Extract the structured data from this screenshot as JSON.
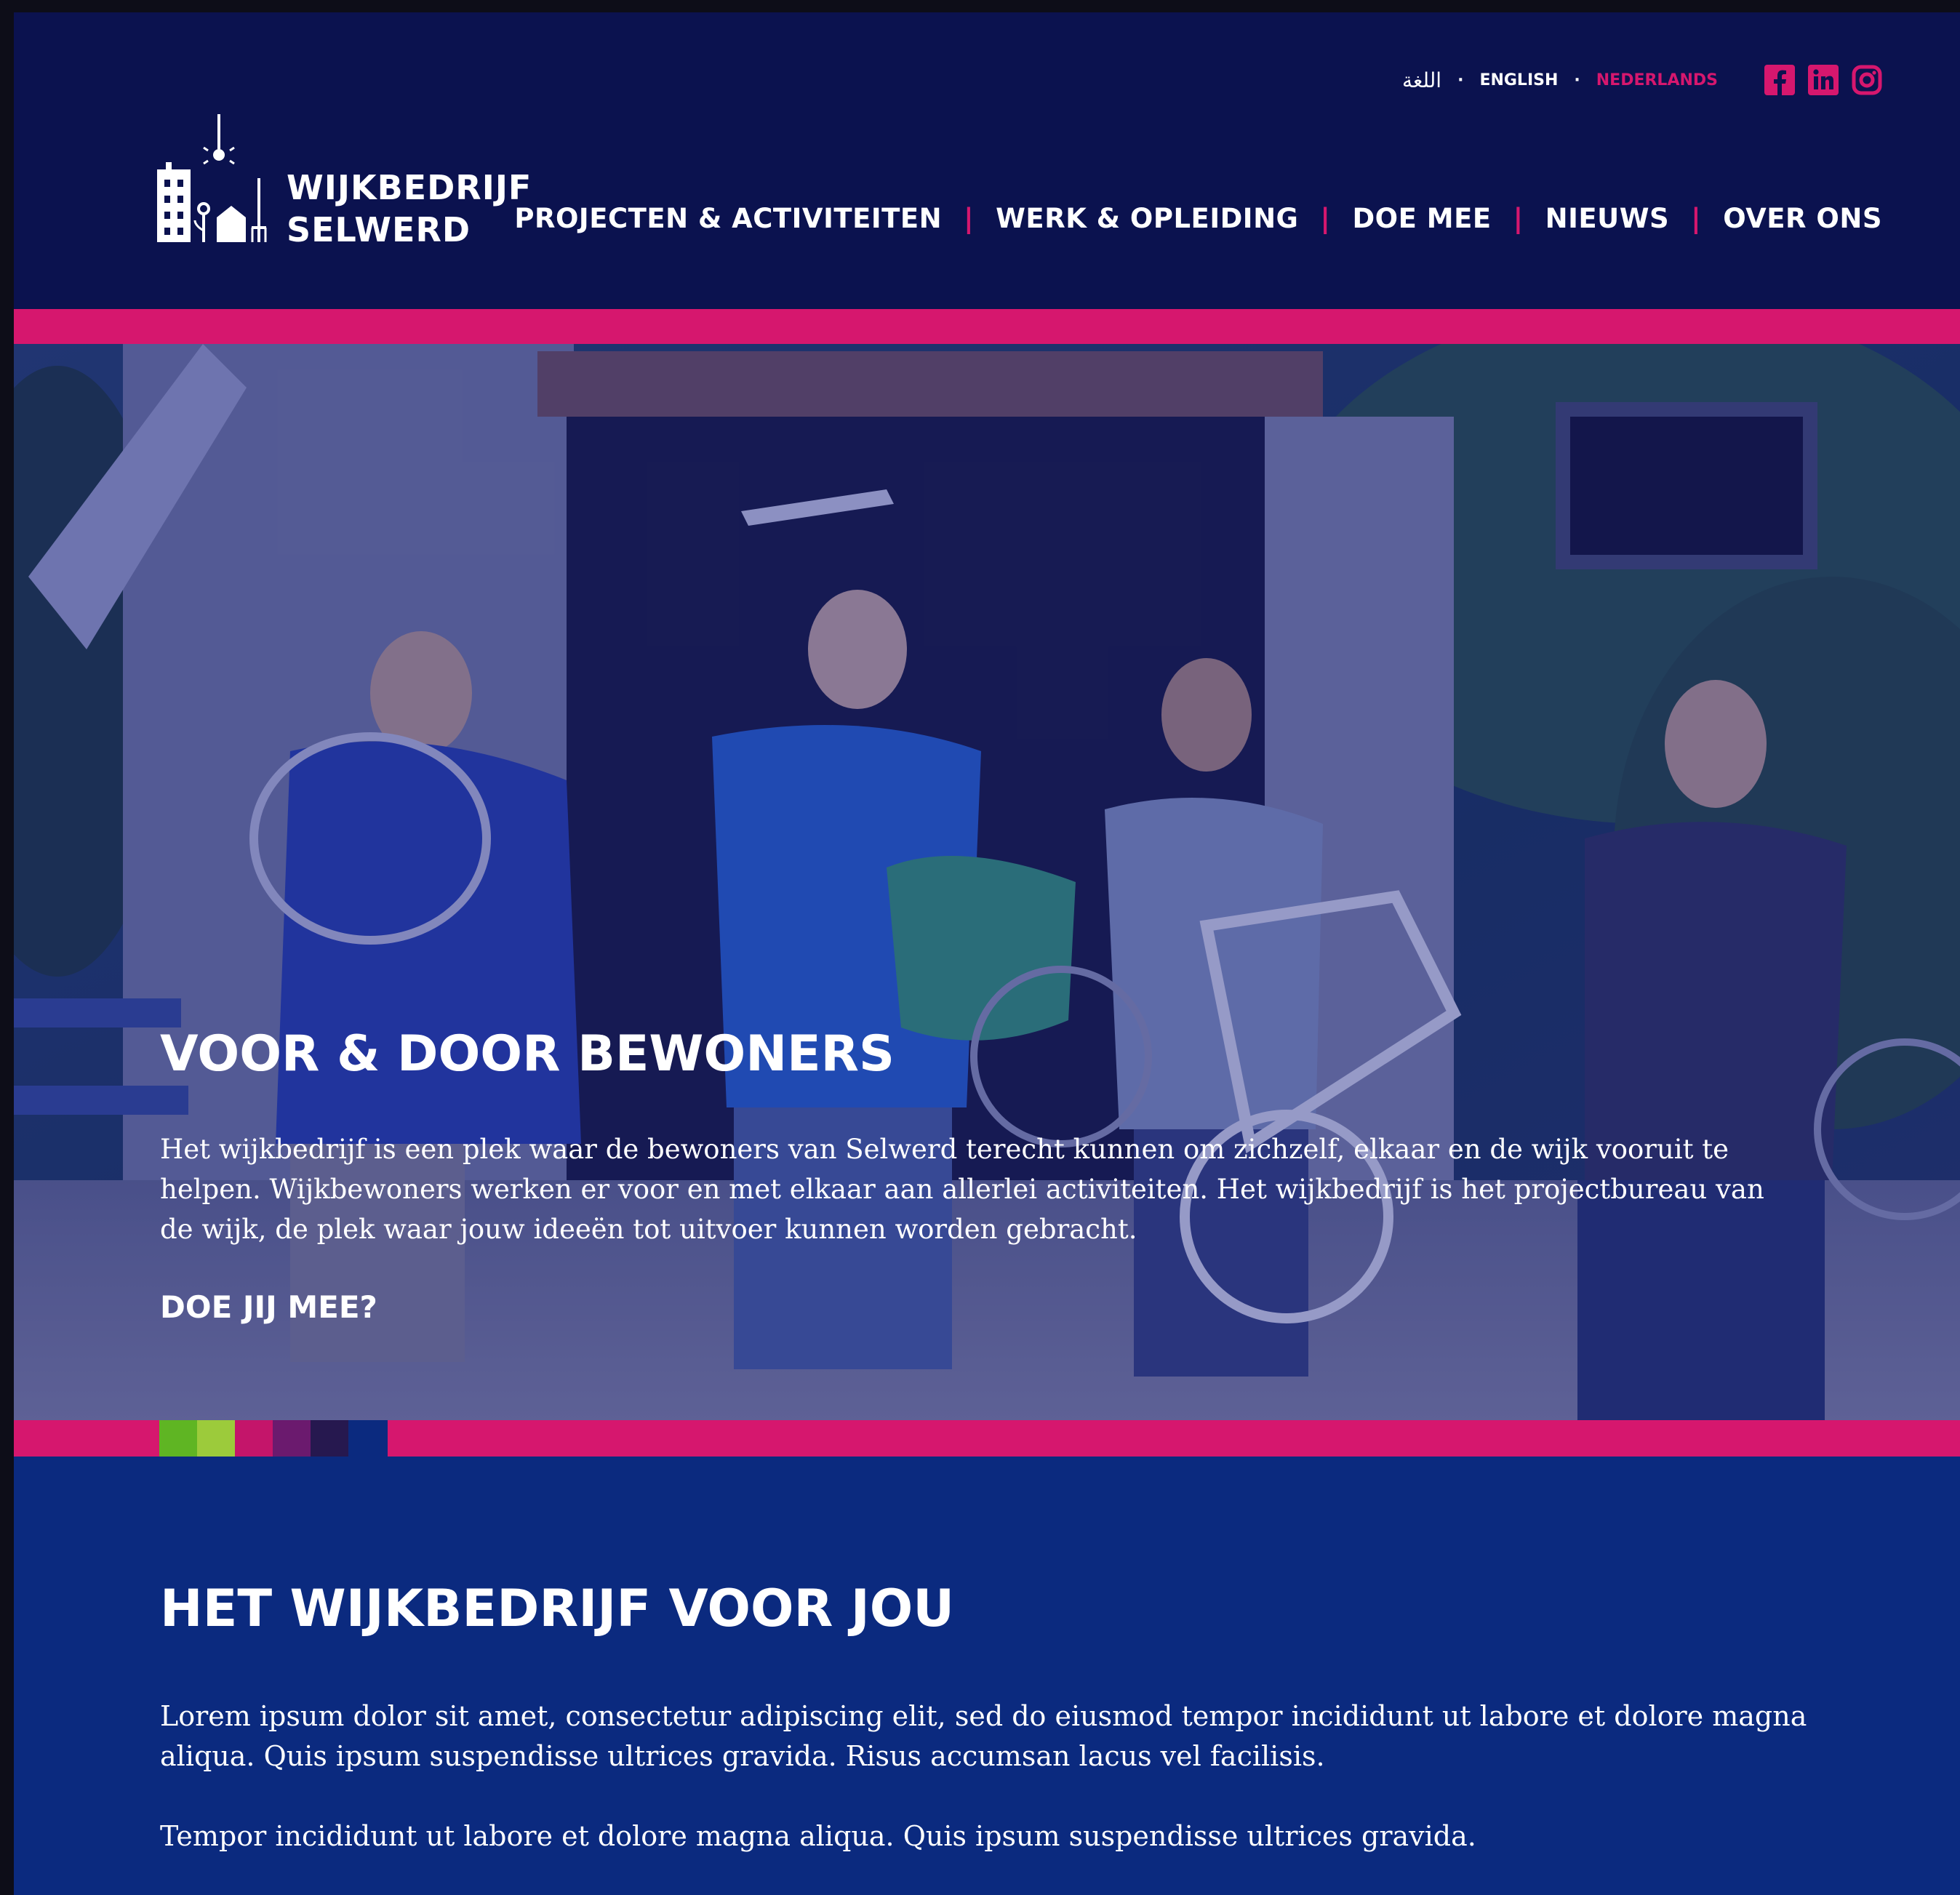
{
  "header": {
    "languages": {
      "arabic": "اللغة",
      "english": "ENGLISH",
      "nederlands": "NEDERLANDS",
      "separator": "·"
    },
    "logo": {
      "line1": "WIJKBEDRIJF",
      "line2": "SELWERD"
    },
    "socials": [
      "facebook-icon",
      "linkedin-icon",
      "instagram-icon"
    ],
    "nav": {
      "items": [
        {
          "label": "PROJECTEN & ACTIVITEITEN"
        },
        {
          "label": "WERK & OPLEIDING"
        },
        {
          "label": "DOE MEE"
        },
        {
          "label": "NIEUWS"
        },
        {
          "label": "OVER ONS"
        }
      ],
      "separator": "|"
    }
  },
  "hero": {
    "title": "VOOR & DOOR BEWONERS",
    "text": "Het wijkbedrijf is een plek waar de bewoners van Selwerd terecht kunnen om zichzelf, elkaar en de wijk vooruit te helpen. Wijkbewoners werken er voor en met elkaar aan allerlei activiteiten. Het wijkbedrijf is het projectbureau van de wijk, de plek waar jouw ideeën tot uitvoer kunnen worden gebracht.",
    "cta": "DOE JIJ MEE?"
  },
  "section": {
    "title": "HET WIJKBEDRIJF VOOR JOU",
    "paragraph1": "Lorem ipsum dolor sit amet, consectetur adipiscing elit, sed do eiusmod tempor incididunt ut labore et dolore magna aliqua. Quis ipsum suspendisse ultrices gravida. Risus accumsan lacus vel facilisis.",
    "paragraph2": "Tempor incididunt ut labore et dolore magna aliqua. Quis ipsum suspendisse ultrices gravida."
  },
  "colors": {
    "navy": "#0b124f",
    "pink": "#d6176e",
    "section_blue": "#0b2a7f",
    "strip_green": "#5fb523",
    "strip_lime": "#9ccb3b",
    "strip_magenta": "#c4156a",
    "strip_purple": "#6b1a6e",
    "strip_indigo": "#26184f",
    "strip_blue": "#0b2a7f"
  }
}
